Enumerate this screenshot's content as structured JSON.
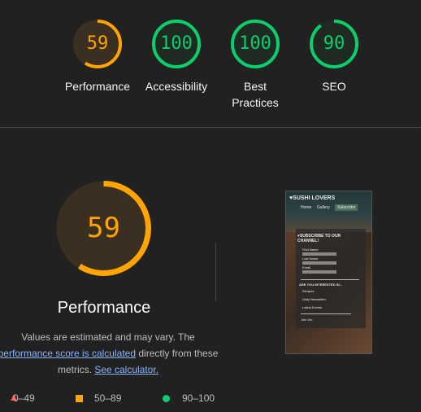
{
  "summary": {
    "scores": [
      {
        "value": "59",
        "label": "Performance",
        "fraction": 0.59,
        "color": "#ffa400",
        "fill": "#3a2f20"
      },
      {
        "value": "100",
        "label": "Accessibility",
        "fraction": 1.0,
        "color": "#0cce6b",
        "fill": "#1f2a22"
      },
      {
        "value": "100",
        "label": "Best Practices",
        "fraction": 1.0,
        "color": "#0cce6b",
        "fill": "#1f2a22"
      },
      {
        "value": "90",
        "label": "SEO",
        "fraction": 0.9,
        "color": "#0cce6b",
        "fill": "#1f2a22"
      }
    ]
  },
  "main": {
    "score": "59",
    "fraction": 0.59,
    "title": "Performance",
    "note_part1": "Values are estimated and may vary. The",
    "note_link1": "performance score is calculated",
    "note_part2": "directly from these metrics.",
    "note_link2": "See calculator."
  },
  "legend": [
    {
      "range": "0–49",
      "icon": "triangle-icon",
      "color": "#ff4e42"
    },
    {
      "range": "50–89",
      "icon": "square-icon",
      "color": "#ffa400"
    },
    {
      "range": "90–100",
      "icon": "circle-icon",
      "color": "#0cce6b"
    }
  ],
  "screenshot": {
    "site_title": "♥SUSHI LOVERS",
    "nav": [
      "Home",
      "Gallery",
      "Subscribe"
    ],
    "heading": "♥SUBSCRIBE TO OUR CHANNEL!",
    "fields": [
      "First Name",
      "Last Name",
      "Email"
    ],
    "question": "ARE YOU INTERESTED IN...",
    "options": [
      "Recipes",
      "Daily Newsletter",
      "Latest Events"
    ],
    "button": "Join Us!"
  },
  "colors": {
    "background": "#212121",
    "orange": "#ffa400",
    "green": "#0cce6b",
    "link": "#8ab4f8"
  }
}
